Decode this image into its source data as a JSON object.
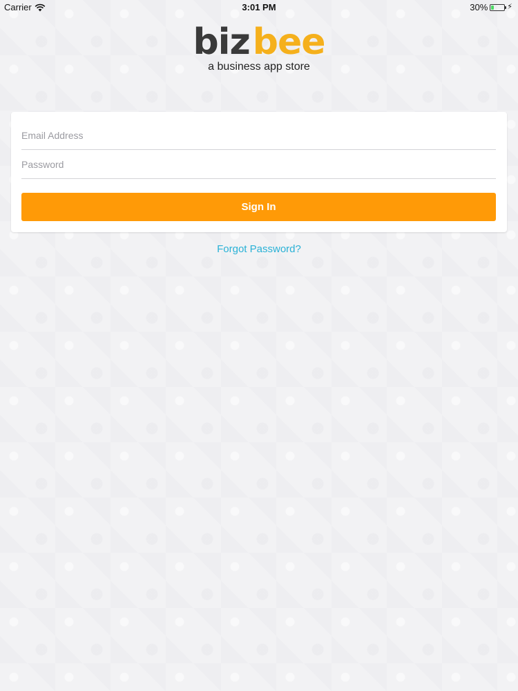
{
  "status_bar": {
    "carrier": "Carrier",
    "time": "3:01 PM",
    "battery_percent_text": "30%",
    "battery_level": 0.3,
    "battery_color": "#4cd964"
  },
  "logo": {
    "part1": "biz",
    "part2": "bee",
    "tagline": "a business app store",
    "color_dark": "#3a3a3a",
    "color_accent": "#f5b01c"
  },
  "login": {
    "email_placeholder": "Email Address",
    "password_placeholder": "Password",
    "signin_label": "Sign In",
    "button_color": "#ff9a07"
  },
  "forgot_password": "Forgot Password?",
  "icons": {
    "wifi": "wifi-icon",
    "battery": "battery-icon",
    "charging": "charging-icon"
  }
}
